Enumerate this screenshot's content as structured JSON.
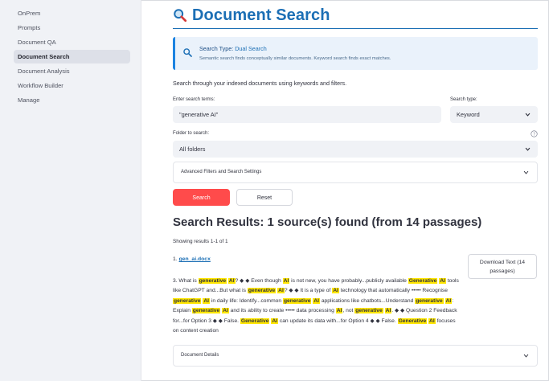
{
  "sidebar": {
    "items": [
      {
        "label": "OnPrem",
        "active": false
      },
      {
        "label": "Prompts",
        "active": false
      },
      {
        "label": "Document QA",
        "active": false
      },
      {
        "label": "Document Search",
        "active": true
      },
      {
        "label": "Document Analysis",
        "active": false
      },
      {
        "label": "Workflow Builder",
        "active": false
      },
      {
        "label": "Manage",
        "active": false
      }
    ]
  },
  "page": {
    "title": "Document Search",
    "title_icon": "magnifier-icon",
    "accent": "#1c6fb5"
  },
  "info": {
    "label": "Search Type: ",
    "value": "Dual Search",
    "description": "Semantic search finds conceptually similar documents. Keyword search finds exact matches."
  },
  "intro": "Search through your indexed documents using keywords and filters.",
  "search": {
    "terms_label": "Enter search terms:",
    "terms_value": "\"generative AI\"",
    "type_label": "Search type:",
    "type_value": "Keyword",
    "folder_label": "Folder to search:",
    "folder_value": "All folders"
  },
  "advanced": {
    "label": "Advanced Filters and Search Settings"
  },
  "buttons": {
    "search": "Search",
    "reset": "Reset",
    "search_color": "#ff4b4b"
  },
  "results": {
    "title": "Search Results: 1 source(s) found (from 14 passages)",
    "showing": "Showing results 1-1 of 1",
    "items": [
      {
        "index": "1. ",
        "filename": "gen_ai.docx",
        "download_label": "Download Text (14 passages)",
        "snippet": [
          {
            "t": "3. What is ",
            "h": false
          },
          {
            "t": "generative",
            "h": true
          },
          {
            "t": " ",
            "h": false
          },
          {
            "t": "AI",
            "h": true
          },
          {
            "t": "? ◆ ◆ Even though ",
            "h": false
          },
          {
            "t": "AI",
            "h": true
          },
          {
            "t": " is not new, you have probably...publicly available ",
            "h": false
          },
          {
            "t": "Generative",
            "h": true
          },
          {
            "t": " ",
            "h": false
          },
          {
            "t": "AI",
            "h": true
          },
          {
            "t": " tools like ChatGPT and...But what is ",
            "h": false
          },
          {
            "t": "generative",
            "h": true
          },
          {
            "t": " ",
            "h": false
          },
          {
            "t": "AI",
            "h": true
          },
          {
            "t": "? ◆ ◆ It is a type of ",
            "h": false
          },
          {
            "t": "AI",
            "h": true
          },
          {
            "t": " technology that automatically ••••• Recognise ",
            "h": false
          },
          {
            "t": "generative",
            "h": true
          },
          {
            "t": " ",
            "h": false
          },
          {
            "t": "AI",
            "h": true
          },
          {
            "t": " in daily life: Identify...common ",
            "h": false
          },
          {
            "t": "generative",
            "h": true
          },
          {
            "t": " ",
            "h": false
          },
          {
            "t": "AI",
            "h": true
          },
          {
            "t": " applications like chatbots...Understand ",
            "h": false
          },
          {
            "t": "generative",
            "h": true
          },
          {
            "t": " ",
            "h": false
          },
          {
            "t": "AI",
            "h": true
          },
          {
            "t": ": Explain ",
            "h": false
          },
          {
            "t": "generative",
            "h": true
          },
          {
            "t": " ",
            "h": false
          },
          {
            "t": "AI",
            "h": true
          },
          {
            "t": " and its ability to create ••••• data processing ",
            "h": false
          },
          {
            "t": "AI",
            "h": true
          },
          {
            "t": ", not ",
            "h": false
          },
          {
            "t": "generative",
            "h": true
          },
          {
            "t": " ",
            "h": false
          },
          {
            "t": "AI",
            "h": true
          },
          {
            "t": ". ◆ ◆ Question 2 Feedback for...for Option 3 ◆ ◆ False. ",
            "h": false
          },
          {
            "t": "Generative",
            "h": true
          },
          {
            "t": " ",
            "h": false
          },
          {
            "t": "AI",
            "h": true
          },
          {
            "t": " can update its data with...for Option 4 ◆ ◆ False. ",
            "h": false
          },
          {
            "t": "Generative",
            "h": true
          },
          {
            "t": " ",
            "h": false
          },
          {
            "t": "AI",
            "h": true
          },
          {
            "t": " focuses on content creation",
            "h": false
          }
        ],
        "details_label": "Document Details"
      }
    ]
  },
  "highlight_color": "#ffe600"
}
